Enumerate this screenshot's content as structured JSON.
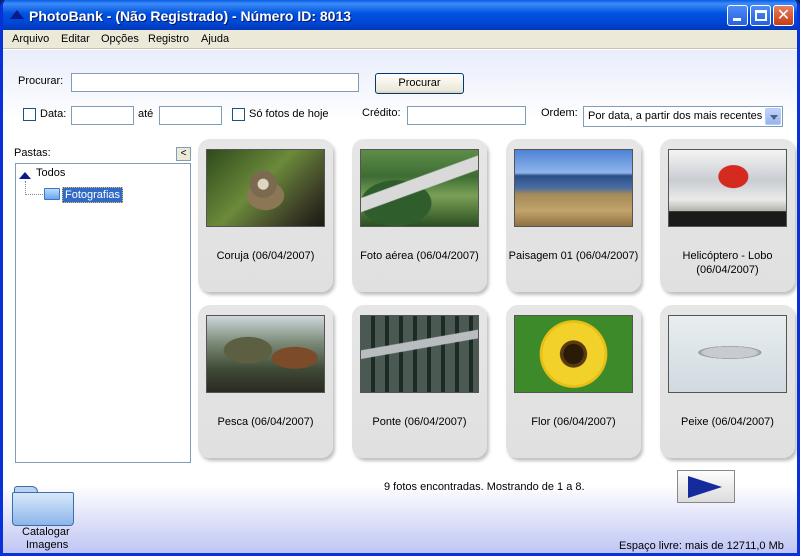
{
  "window": {
    "title": "PhotoBank - (Não Registrado) - Número ID: 8013",
    "minimize_glyph": "",
    "close_glyph": "✕"
  },
  "menu": [
    {
      "label": "Arquivo"
    },
    {
      "label": "Editar"
    },
    {
      "label": "Opções"
    },
    {
      "label": "Registro"
    },
    {
      "label": "Ajuda"
    }
  ],
  "search": {
    "label": "Procurar:",
    "value": "",
    "button_label": "Procurar"
  },
  "filters": {
    "date_label": "Data:",
    "date_from": "",
    "until_label": "até",
    "date_to": "",
    "today_label": "Só fotos de hoje",
    "credit_label": "Crédito:",
    "credit_value": "",
    "order_label": "Ordem:",
    "order_value": "Por data, a partir dos mais recentes"
  },
  "folders": {
    "label": "Pastas:",
    "collapse_glyph": "<",
    "root": "Todos",
    "children": [
      "Fotografias"
    ]
  },
  "photos": [
    {
      "caption": "Coruja (06/04/2007)"
    },
    {
      "caption": "Foto aérea (06/04/2007)"
    },
    {
      "caption": "Paisagem 01 (06/04/2007)"
    },
    {
      "caption": "Helicóptero - Lobo (06/04/2007)"
    },
    {
      "caption": "Pesca (06/04/2007)"
    },
    {
      "caption": "Ponte (06/04/2007)"
    },
    {
      "caption": "Flor (06/04/2007)"
    },
    {
      "caption": "Peixe (06/04/2007)"
    }
  ],
  "status": {
    "results": "9 fotos encontradas. Mostrando de 1 a 8.",
    "free_space": "Espaço livre: mais de 12711,0 Mb"
  },
  "catalog": {
    "label_line1": "Catalogar",
    "label_line2": "Imagens"
  },
  "icons": {
    "app": "photobank-logo-icon",
    "next": "next-page-arrow-icon",
    "folder": "folder-icon",
    "catalog": "catalog-folder-icon"
  },
  "colors": {
    "titlebar": "#0052e0",
    "selection": "#316ac5",
    "next_arrow": "#152a9c",
    "card": "#e2e2e2"
  }
}
